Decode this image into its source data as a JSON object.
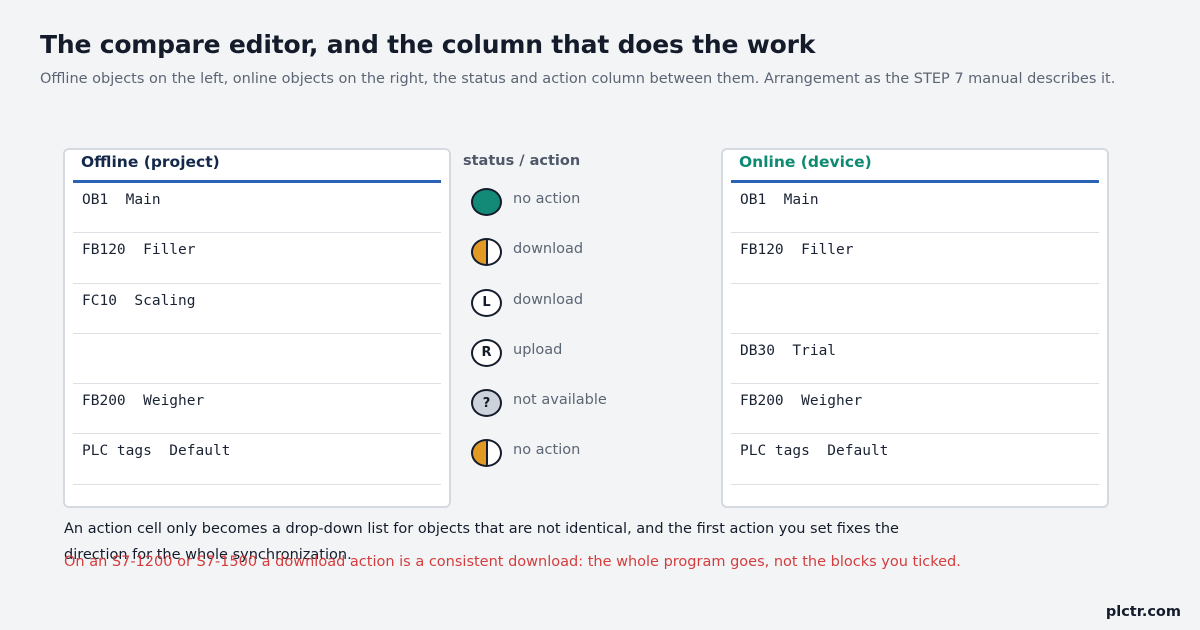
{
  "header": {
    "title": "The compare editor, and the column that does the work",
    "subtitle": "Offline objects on the left, online objects on the right, the status and action column between them. Arrangement as the STEP 7 manual describes it."
  },
  "offline": {
    "header": "Offline  (project)",
    "rows": [
      "OB1  Main",
      "FB120  Filler",
      "FC10  Scaling",
      "",
      "FB200  Weigher",
      "PLC tags  Default"
    ]
  },
  "online": {
    "header": "Online  (device)",
    "rows": [
      "OB1  Main",
      "FB120  Filler",
      "",
      "DB30  Trial",
      "FB200  Weigher",
      "PLC tags  Default"
    ]
  },
  "status": {
    "header": "status / action",
    "rows": [
      {
        "icon": "filled-green-circle-icon",
        "glyph": "",
        "label": "no action"
      },
      {
        "icon": "half-filled-circle-icon",
        "glyph": "",
        "label": "download"
      },
      {
        "icon": "left-letter-circle-icon",
        "glyph": "L",
        "label": "download"
      },
      {
        "icon": "right-letter-circle-icon",
        "glyph": "R",
        "label": "upload"
      },
      {
        "icon": "question-circle-icon",
        "glyph": "?",
        "label": "not available"
      },
      {
        "icon": "half-filled-circle-icon",
        "glyph": "",
        "label": "no action"
      }
    ]
  },
  "notes": {
    "note": "An action cell only becomes a drop-down list for objects that are not identical, and the first action you set fixes the direction for the whole synchronization.",
    "warning": "On an S7-1200 or S7-1500 a download action is a consistent download: the whole program goes, not the blocks you ticked."
  },
  "brand": "plctr.com",
  "colors": {
    "accent_blue": "#2b63b5",
    "online_green": "#0e8a72",
    "status_green": "#138a77",
    "status_orange": "#e39a25",
    "warning_red": "#d43d3d"
  }
}
